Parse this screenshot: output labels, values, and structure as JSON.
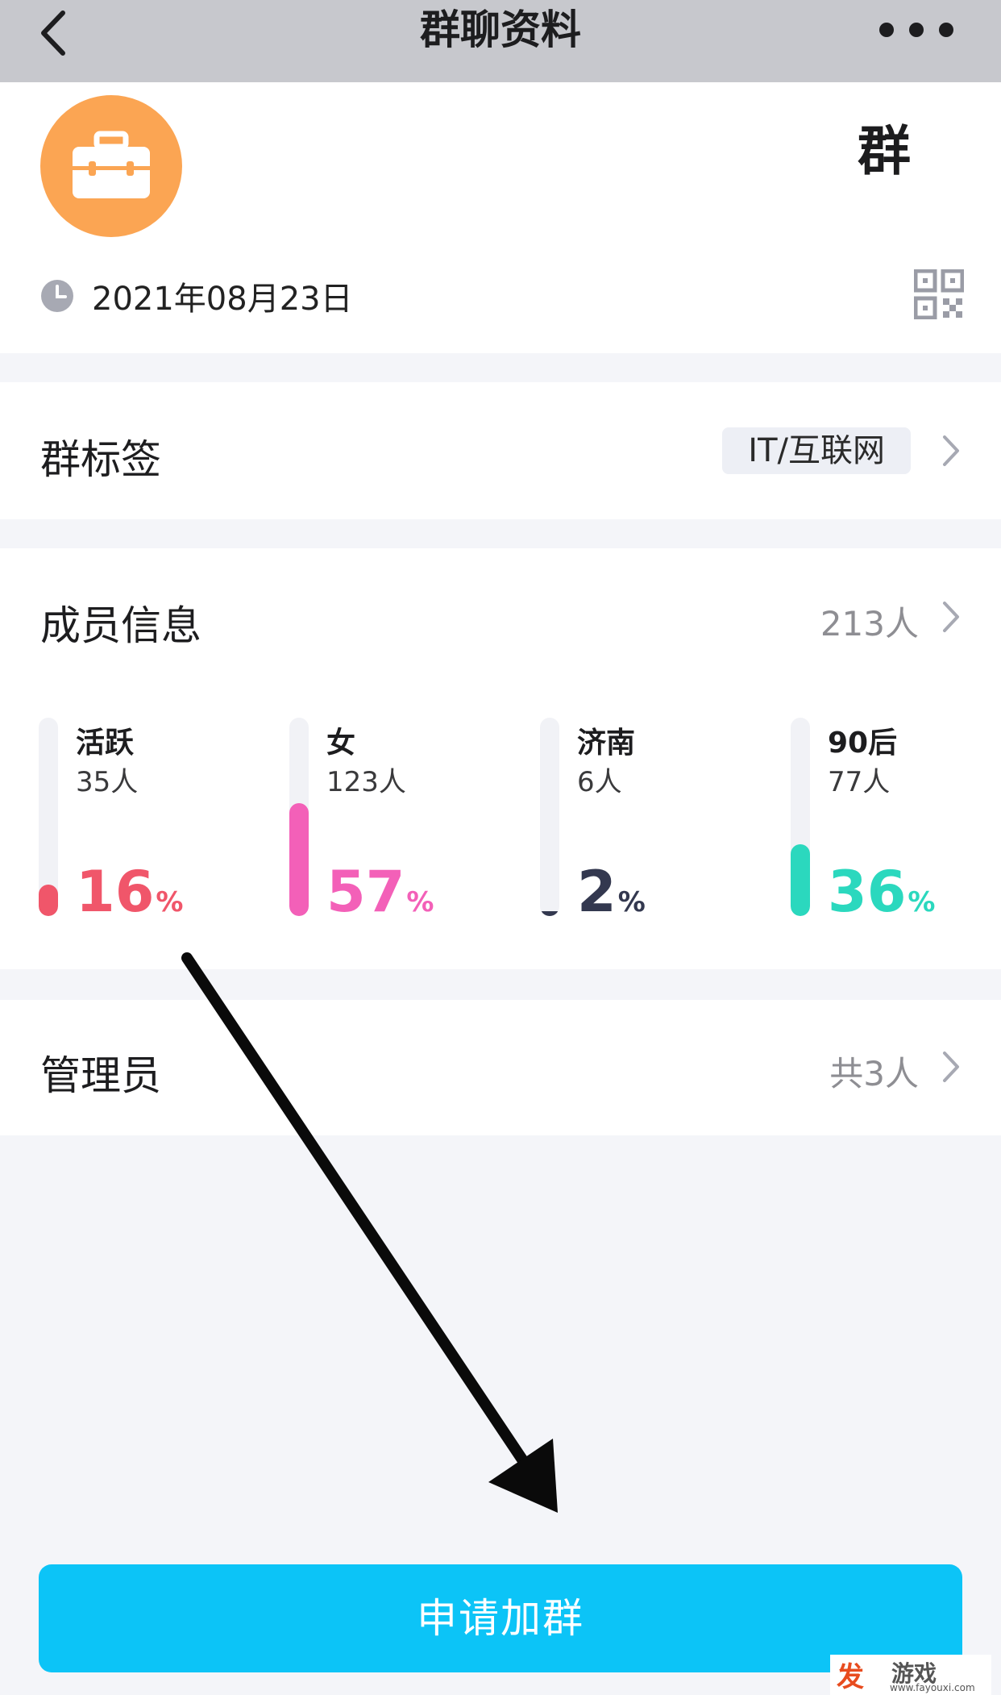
{
  "nav": {
    "title": "群聊资料"
  },
  "header": {
    "group_name_tail": "群",
    "date": "2021年08月23日"
  },
  "tags": {
    "label": "群标签",
    "tag": "IT/互联网"
  },
  "members": {
    "label": "成员信息",
    "count": "213人",
    "stats": [
      {
        "label": "活跃",
        "count": "35人",
        "percent": "16",
        "unit": "%",
        "fraction": 0.16,
        "color": "#f0566a"
      },
      {
        "label": "女",
        "count": "123人",
        "percent": "57",
        "unit": "%",
        "fraction": 0.57,
        "color": "#f360b8"
      },
      {
        "label": "济南",
        "count": "6人",
        "percent": "2",
        "unit": "%",
        "fraction": 0.02,
        "color": "#33384f"
      },
      {
        "label": "90后",
        "count": "77人",
        "percent": "36",
        "unit": "%",
        "fraction": 0.36,
        "color": "#2bd8be"
      }
    ]
  },
  "admins": {
    "label": "管理员",
    "count": "共3人"
  },
  "action": {
    "join_label": "申请加群"
  },
  "watermark": {
    "brand_char": "发",
    "brand": "游戏",
    "url": "www.fayouxi.com"
  }
}
